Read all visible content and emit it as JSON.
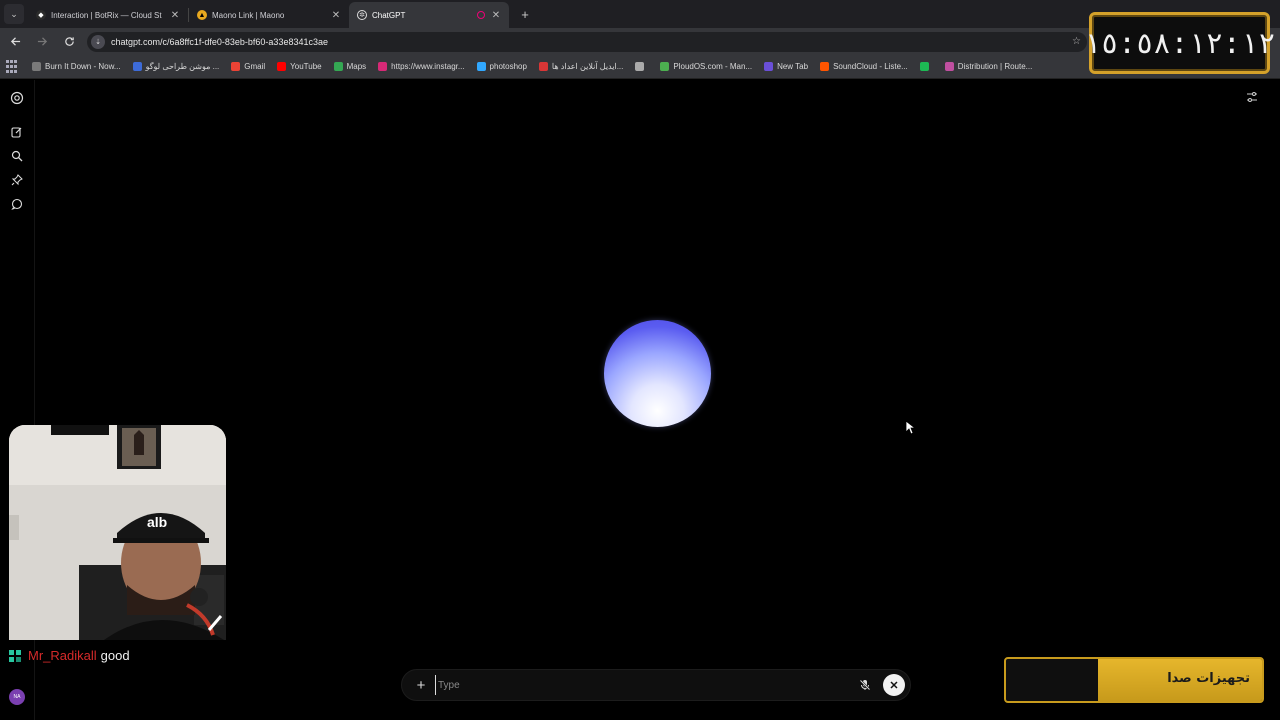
{
  "browser": {
    "tabs": [
      {
        "title": "Interaction | BotRix — Cloud St",
        "active": false
      },
      {
        "title": "Maono Link | Maono",
        "active": false
      },
      {
        "title": "ChatGPT",
        "active": true
      }
    ],
    "url": "chatgpt.com/c/6a8ffc1f-dfe0-83eb-bf60-a33e8341c3ae",
    "bookmarks": [
      {
        "label": "Burn It Down - Now...",
        "color": "#7a7a7a"
      },
      {
        "label": "موشن طراحی لوگو ...",
        "color": "#3d6bd8"
      },
      {
        "label": "Gmail",
        "color": "#ea4335"
      },
      {
        "label": "YouTube",
        "color": "#ff0000"
      },
      {
        "label": "Maps",
        "color": "#34a853"
      },
      {
        "label": "https://www.instagr...",
        "color": "#d62976"
      },
      {
        "label": "photoshop",
        "color": "#31a8ff"
      },
      {
        "label": "ایدیل آنلاین اعداد ها...",
        "color": "#d93636"
      },
      {
        "label": "",
        "color": "#aaaaaa"
      },
      {
        "label": "PloudOS.com - Man...",
        "color": "#4caf50"
      },
      {
        "label": "New Tab",
        "color": "#6a4fd8"
      },
      {
        "label": "SoundCloud - Liste...",
        "color": "#ff5500"
      },
      {
        "label": "",
        "color": "#1db954"
      },
      {
        "label": "Distribution | Route...",
        "color": "#c04fa0"
      }
    ]
  },
  "chatgpt": {
    "composer_placeholder": "Type",
    "accent_orb": "#5a5cf0",
    "avatar_initials": "NA"
  },
  "stream": {
    "clock": "١٥:٥٨:١٢:١٢",
    "chat": {
      "user": "Mr_Radikall",
      "message": "good"
    },
    "sponsor_label": "تجهیزات صدا",
    "sponsor_progress": 0.64
  }
}
